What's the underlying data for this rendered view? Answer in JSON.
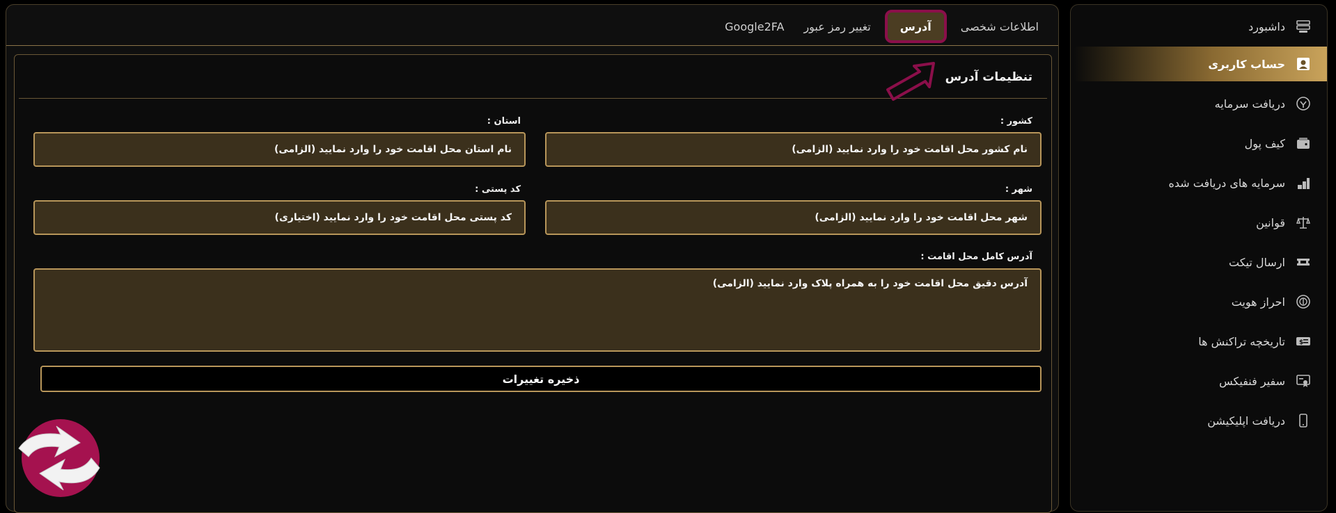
{
  "sidebar": {
    "items": [
      {
        "label": "داشبورد",
        "icon": "dashboard-icon",
        "active": false
      },
      {
        "label": "حساب کاربری",
        "icon": "user-account-icon",
        "active": true
      },
      {
        "label": "دریافت سرمایه",
        "icon": "receive-capital-icon",
        "active": false
      },
      {
        "label": "کیف پول",
        "icon": "wallet-icon",
        "active": false
      },
      {
        "label": "سرمایه های دریافت شده",
        "icon": "received-capital-icon",
        "active": false
      },
      {
        "label": "قوانین",
        "icon": "rules-scale-icon",
        "active": false
      },
      {
        "label": "ارسال تیکت",
        "icon": "ticket-icon",
        "active": false
      },
      {
        "label": "احراز هویت",
        "icon": "identity-verify-icon",
        "active": false
      },
      {
        "label": "تاریخچه تراکنش ها",
        "icon": "transaction-history-icon",
        "active": false
      },
      {
        "label": "سفیر فنفیکس",
        "icon": "ambassador-icon",
        "active": false
      },
      {
        "label": "دریافت اپلیکیشن",
        "icon": "mobile-app-icon",
        "active": false
      }
    ]
  },
  "tabs": [
    {
      "label": "اطلاعات شخصی",
      "active": false
    },
    {
      "label": "آدرس",
      "active": true
    },
    {
      "label": "تغییر رمز عبور",
      "active": false
    },
    {
      "label": "Google2FA",
      "active": false
    }
  ],
  "card": {
    "title": "تنظیمات آدرس",
    "country_label": "کشور :",
    "country_placeholder": "نام کشور محل اقامت خود را وارد نمایید (الزامی)",
    "province_label": "استان :",
    "province_placeholder": "نام استان محل اقامت خود را وارد نمایید (الزامی)",
    "city_label": "شهر :",
    "city_placeholder": "شهر محل اقامت خود را وارد نمایید (الزامی)",
    "postal_label": "کد پستی :",
    "postal_placeholder": "کد پستی محل اقامت خود را وارد نمایید (اختیاری)",
    "address_label": "آدرس کامل محل اقامت :",
    "address_placeholder": "آدرس دقیق محل اقامت خود را به همراه پلاک وارد نمایید (الزامی)",
    "save_label": "ذخیره تغییرات"
  },
  "colors": {
    "accent_gold": "#b8965a",
    "active_tab_border": "#8b0f4a",
    "field_bg": "#3b301c"
  }
}
